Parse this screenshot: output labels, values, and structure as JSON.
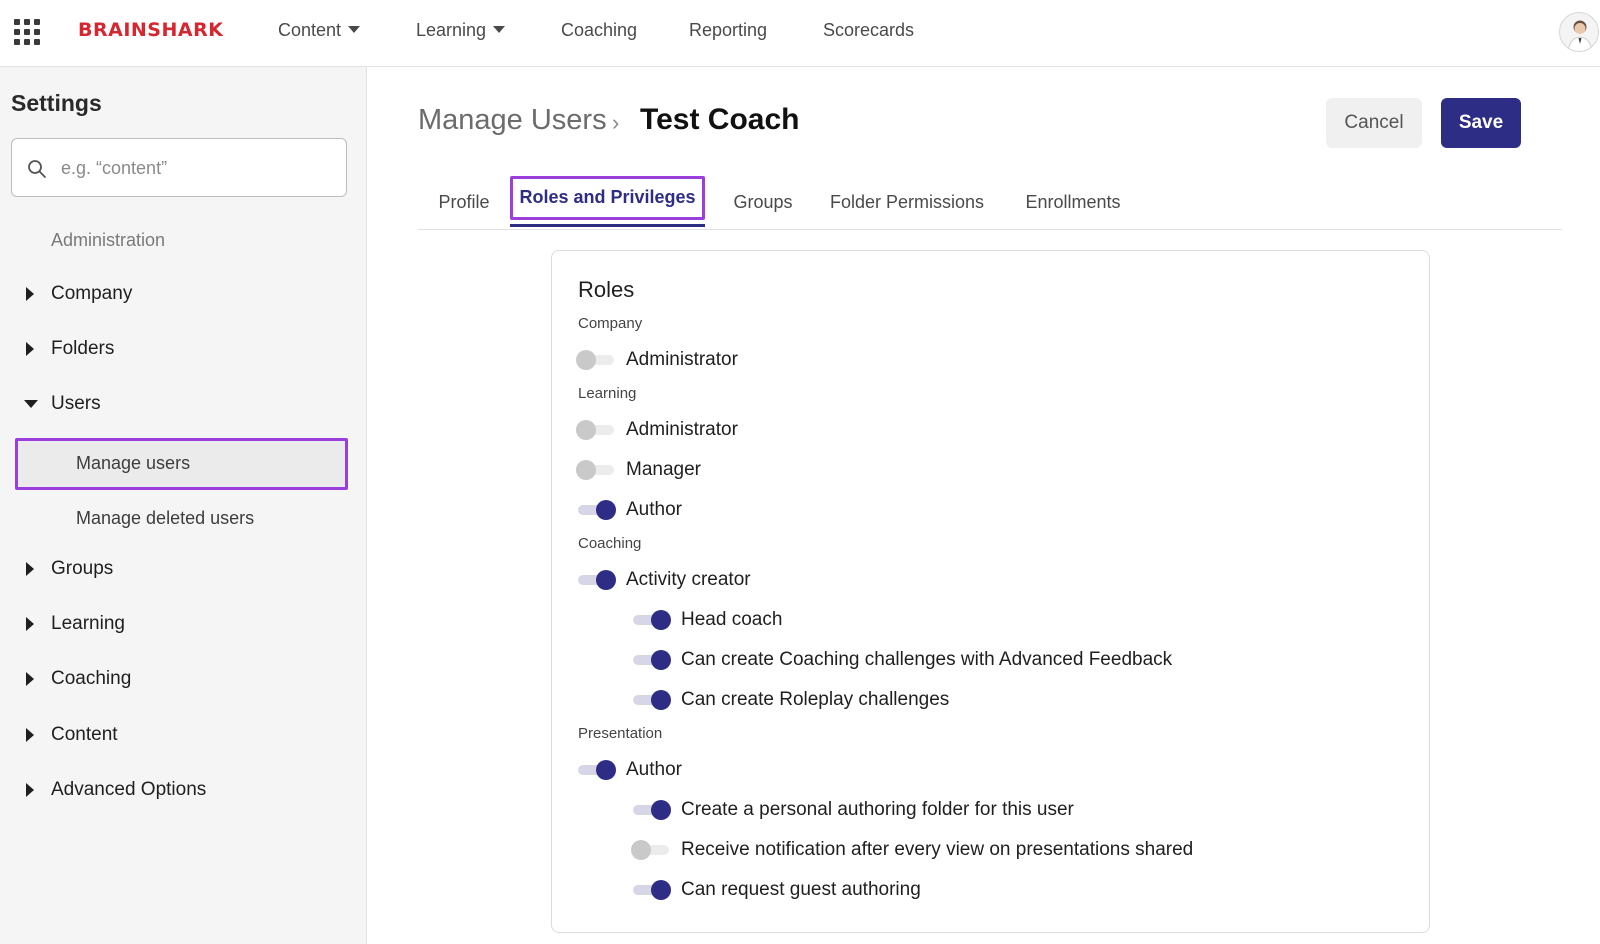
{
  "topbar": {
    "logo": "BRAINSHARK",
    "nav": [
      {
        "label": "Content",
        "has_menu": true
      },
      {
        "label": "Learning",
        "has_menu": true
      },
      {
        "label": "Coaching",
        "has_menu": false
      },
      {
        "label": "Reporting",
        "has_menu": false
      },
      {
        "label": "Scorecards",
        "has_menu": false
      }
    ],
    "icons": {
      "apps": "grid-menu-icon",
      "avatar": "user-avatar"
    }
  },
  "sidebar": {
    "title": "Settings",
    "search_placeholder": "e.g. “content”",
    "section_label": "Administration",
    "items": [
      {
        "label": "Company",
        "expanded": false
      },
      {
        "label": "Folders",
        "expanded": false
      },
      {
        "label": "Users",
        "expanded": true
      },
      {
        "label": "Groups",
        "expanded": false
      },
      {
        "label": "Learning",
        "expanded": false
      },
      {
        "label": "Coaching",
        "expanded": false
      },
      {
        "label": "Content",
        "expanded": false
      },
      {
        "label": "Advanced Options",
        "expanded": false
      }
    ],
    "users_children": [
      {
        "label": "Manage users",
        "active": true
      },
      {
        "label": "Manage deleted users",
        "active": false
      }
    ]
  },
  "main": {
    "breadcrumb": {
      "parent": "Manage Users",
      "separator": "›",
      "current": "Test Coach"
    },
    "buttons": {
      "cancel": "Cancel",
      "save": "Save"
    },
    "tabs": [
      {
        "label": "Profile",
        "active": false
      },
      {
        "label": "Roles and Privileges",
        "active": true
      },
      {
        "label": "Groups",
        "active": false
      },
      {
        "label": "Folder Permissions",
        "active": false
      },
      {
        "label": "Enrollments",
        "active": false
      }
    ],
    "roles": {
      "title": "Roles",
      "groups": [
        {
          "label": "Company",
          "roles": [
            {
              "label": "Administrator",
              "enabled": false
            }
          ]
        },
        {
          "label": "Learning",
          "roles": [
            {
              "label": "Administrator",
              "enabled": false
            },
            {
              "label": "Manager",
              "enabled": false
            },
            {
              "label": "Author",
              "enabled": true
            }
          ]
        },
        {
          "label": "Coaching",
          "roles": [
            {
              "label": "Activity creator",
              "enabled": true
            },
            {
              "label": "Head coach",
              "enabled": true,
              "indent": true
            },
            {
              "label": "Can create Coaching challenges with Advanced Feedback",
              "enabled": true,
              "indent": true
            },
            {
              "label": "Can create Roleplay challenges",
              "enabled": true,
              "indent": true
            }
          ]
        },
        {
          "label": "Presentation",
          "roles": [
            {
              "label": "Author",
              "enabled": true
            },
            {
              "label": "Create a personal authoring folder for this user",
              "enabled": true,
              "indent": true
            },
            {
              "label": "Receive notification after every view on presentations shared",
              "enabled": false,
              "indent": true
            },
            {
              "label": "Can request guest authoring",
              "enabled": true,
              "indent": true
            }
          ]
        }
      ]
    }
  },
  "colors": {
    "brand": "#d6262f",
    "primary": "#2d2d86",
    "highlight": "#9b3fdc"
  }
}
